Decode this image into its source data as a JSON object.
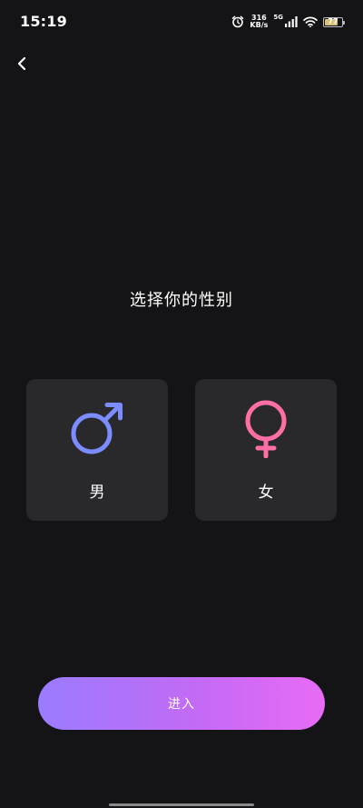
{
  "status_bar": {
    "time": "15:19",
    "net_speed_value": "316",
    "net_speed_unit": "KB/s",
    "network_type": "5G",
    "battery_level": "77",
    "battery_fraction": 0.77
  },
  "page": {
    "title": "选择你的性别"
  },
  "options": {
    "male": {
      "label": "男",
      "icon": "male-symbol-icon",
      "color": "#7b8cff"
    },
    "female": {
      "label": "女",
      "icon": "female-symbol-icon",
      "color": "#ff6fa5"
    }
  },
  "actions": {
    "enter_label": "进入"
  },
  "colors": {
    "background": "#141416",
    "card": "#29292c",
    "button_gradient_start": "#9a7cff",
    "button_gradient_end": "#e86bf5"
  }
}
